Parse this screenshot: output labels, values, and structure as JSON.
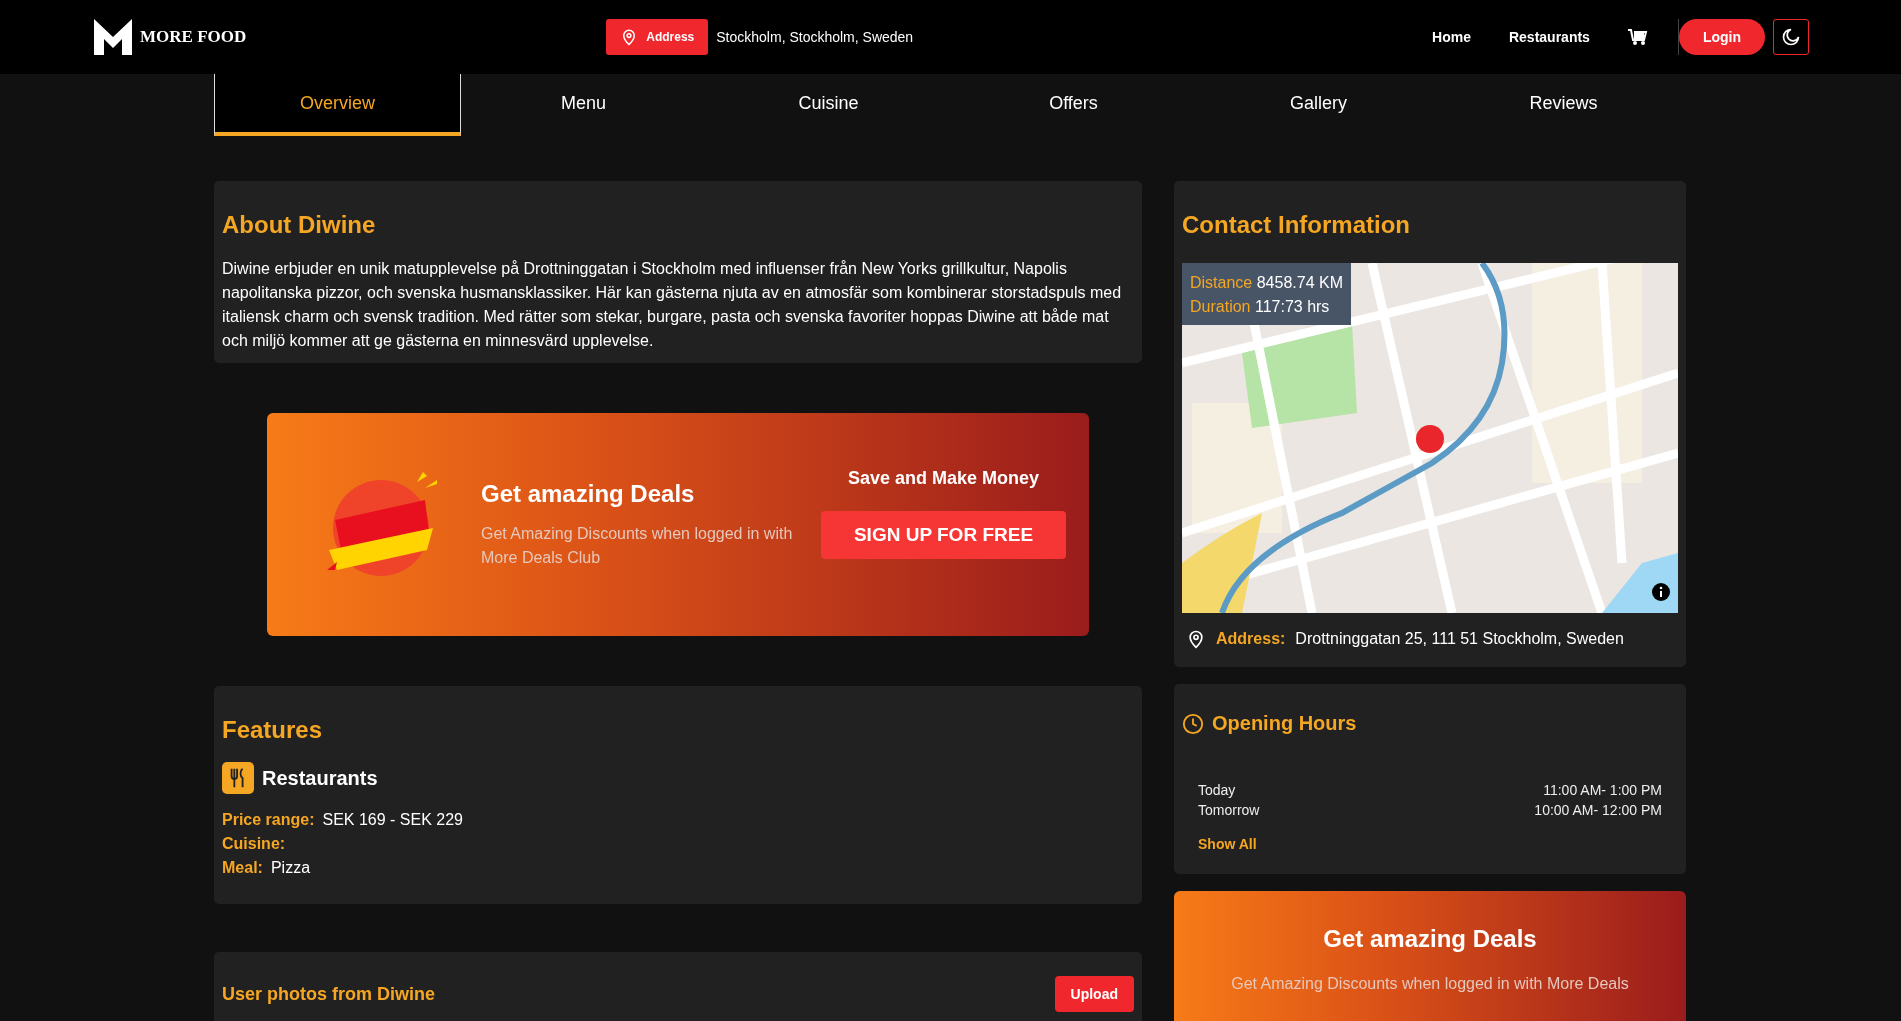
{
  "header": {
    "brand": "MORE FOOD",
    "address_button": "Address",
    "location": "Stockholm, Stockholm, Sweden",
    "nav": [
      "Home",
      "Restaurants"
    ],
    "login": "Login"
  },
  "tabs": [
    {
      "label": "Overview",
      "selected": true
    },
    {
      "label": "Menu",
      "selected": false
    },
    {
      "label": "Cuisine",
      "selected": false
    },
    {
      "label": "Offers",
      "selected": false
    },
    {
      "label": "Gallery",
      "selected": false
    },
    {
      "label": "Reviews",
      "selected": false
    }
  ],
  "about": {
    "title": "About Diwine",
    "text": "Diwine erbjuder en unik matupplevelse på Drottninggatan i Stockholm med influenser från New Yorks grillkultur, Napolis napolitanska pizzor, och svenska husmansklassiker. Här kan gästerna njuta av en atmosfär som kombinerar storstadspuls med italiensk charm och svensk tradition. Med rätter som stekar, burgare, pasta och svenska favoriter hoppas Diwine att både mat och miljö kommer att ge gästerna en minnesvärd upplevelse."
  },
  "deals_banner": {
    "title": "Get amazing Deals",
    "text": "Get Amazing Discounts when logged in with More Deals Club",
    "side_title": "Save and Make Money",
    "button": "SIGN UP FOR FREE"
  },
  "features": {
    "title": "Features",
    "category": "Restaurants",
    "rows": [
      {
        "label": "Price range:",
        "value": "SEK 169 - SEK 229"
      },
      {
        "label": "Cuisine:"
      },
      {
        "label": "Meal:",
        "value": "Pizza"
      }
    ]
  },
  "user_photos": {
    "title": "User photos from Diwine",
    "button": "Upload"
  },
  "contact": {
    "title": "Contact Information",
    "map": {
      "distance_label": "Distance",
      "distance": "8458.74 KM",
      "duration_label": "Duration",
      "duration": "117:73 hrs"
    },
    "address_label": "Address:",
    "address": "Drottninggatan 25, 111 51 Stockholm, Sweden"
  },
  "opening_hours": {
    "title": "Opening Hours",
    "rows": [
      {
        "day": "Today",
        "hours": "11:00 AM- 1:00 PM"
      },
      {
        "day": "Tomorrow",
        "hours": "10:00 AM- 12:00 PM"
      }
    ],
    "show_all": "Show All"
  },
  "side_deals": {
    "title": "Get amazing Deals",
    "text": "Get Amazing Discounts when logged in with More Deals"
  }
}
